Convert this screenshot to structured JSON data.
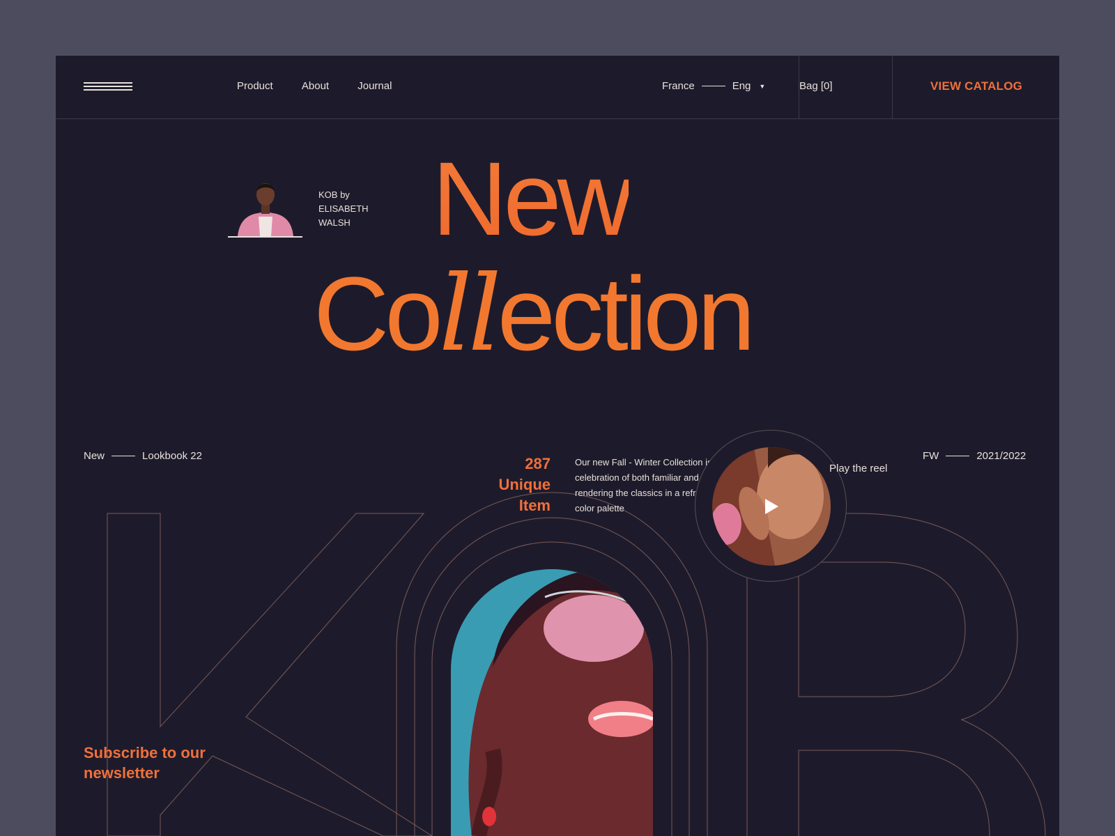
{
  "header": {
    "nav": [
      "Product",
      "About",
      "Journal"
    ],
    "country": "France",
    "language": "Eng",
    "bag": "Bag [0]",
    "catalog": "VIEW CATALOG"
  },
  "hero": {
    "designer_caption": "KOB by ELISABETH WALSH",
    "title_line1": "New",
    "title_line2_pre": "Co",
    "title_line2_ll": "ll",
    "title_line2_post": "ection"
  },
  "info": {
    "left_a": "New",
    "left_b": "Lookbook 22",
    "count_number": "287",
    "count_label": "Unique Item",
    "description": "Our new Fall - Winter Collection is a celebration of both familiar and new, rendering the classics in a refreshed color palette",
    "right_a": "FW",
    "right_b": "2021/2022"
  },
  "reel": {
    "label": "Play the reel"
  },
  "subscribe": "Subscribe to our newsletter",
  "colors": {
    "background": "#1d1b2b",
    "accent": "#f0703a",
    "text": "#e9e1dc",
    "outline": "#7a5a58"
  },
  "icons": [
    "menu-icon",
    "chevron-down-icon",
    "play-icon"
  ]
}
